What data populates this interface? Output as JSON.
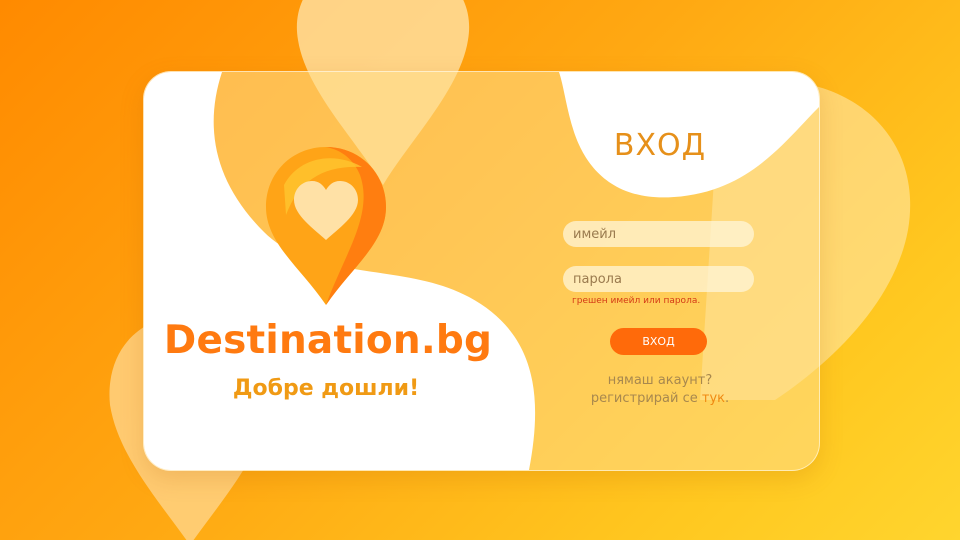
{
  "brand": {
    "name": "Destination.bg",
    "welcome": "Добре дошли!"
  },
  "login": {
    "title": "ВХОД",
    "email_placeholder": "имейл",
    "password_placeholder": "парола",
    "error": "грешен имейл или парола.",
    "submit_label": "ВХОД",
    "no_account": "нямаш акаунт?",
    "register_prefix": "регистрирай се ",
    "register_link": "тук",
    "register_suffix": "."
  },
  "icons": {
    "logo": "heart-location-pin-icon"
  },
  "colors": {
    "brand_orange": "#ff7a10",
    "button": "#ff6a0a",
    "error": "#d43a16",
    "title": "#e6901a"
  }
}
